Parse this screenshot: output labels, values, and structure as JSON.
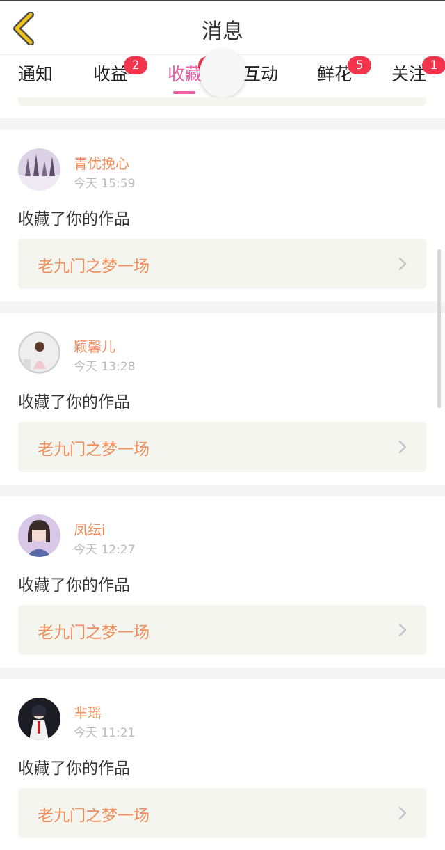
{
  "header": {
    "title": "消息"
  },
  "tabs": [
    {
      "label": "通知",
      "badge": ""
    },
    {
      "label": "收益",
      "badge": "2"
    },
    {
      "label": "收藏",
      "badge": ""
    },
    {
      "label": "互动",
      "badge": ""
    },
    {
      "label": "鲜花",
      "badge": "5"
    },
    {
      "label": "关注",
      "badge": "1"
    }
  ],
  "messages": [
    {
      "username": "青优挽心",
      "time": "今天 15:59",
      "action": "收藏了你的作品",
      "work_title": "老九门之梦一场"
    },
    {
      "username": "颖馨儿",
      "time": "今天 13:28",
      "action": "收藏了你的作品",
      "work_title": "老九门之梦一场"
    },
    {
      "username": "凤纭i",
      "time": "今天 12:27",
      "action": "收藏了你的作品",
      "work_title": "老九门之梦一场"
    },
    {
      "username": "芈瑶",
      "time": "今天 11:21",
      "action": "收藏了你的作品",
      "work_title": "老九门之梦一场"
    }
  ],
  "colors": {
    "accent_pink": "#e85fa3",
    "username_orange": "#f08c5a",
    "badge_red": "#f2354d",
    "back_icon_yellow": "#f2c418"
  }
}
